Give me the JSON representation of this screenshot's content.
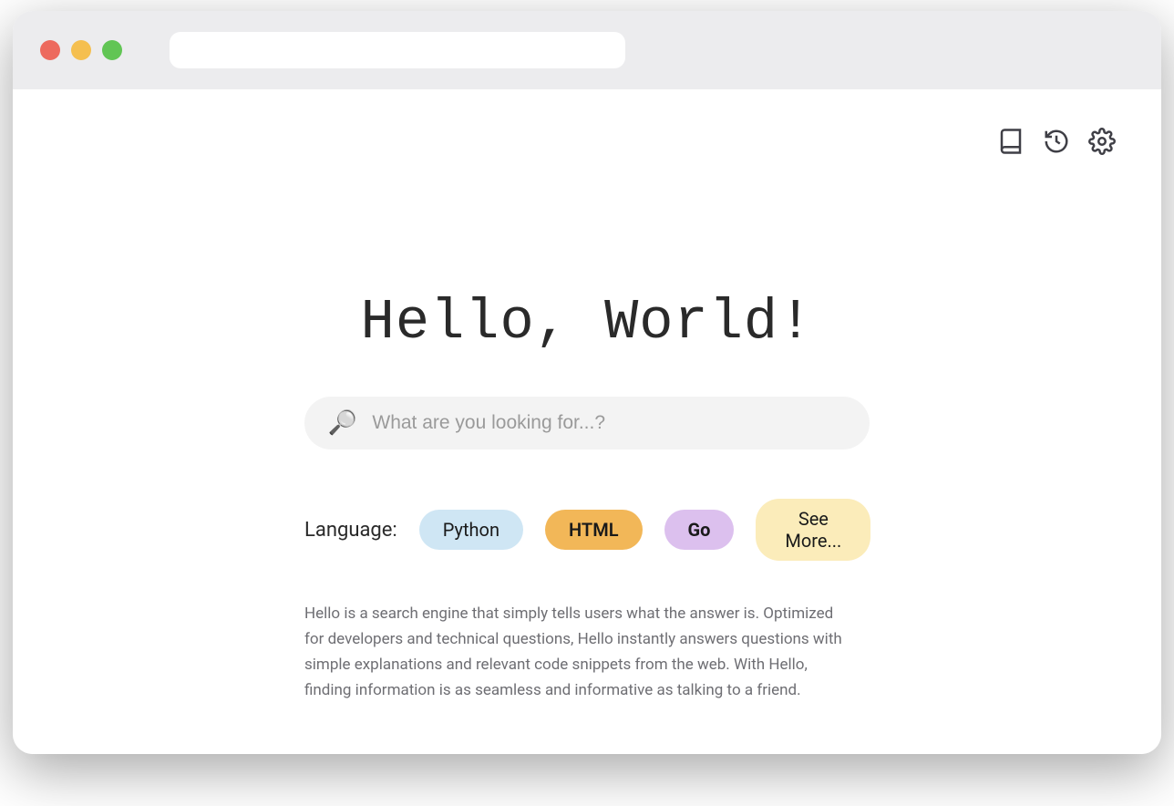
{
  "hero_title": "Hello, World!",
  "search": {
    "placeholder": "What are you looking for...?"
  },
  "language": {
    "label": "Language:",
    "pills": {
      "python": "Python",
      "html": "HTML",
      "go": "Go",
      "more": "See More..."
    }
  },
  "description": "Hello is a search engine that simply tells users what the answer is. Optimized for developers and technical questions, Hello instantly answers questions with simple explanations and relevant code snippets from the web. With Hello, finding information is as seamless and informative as talking to a friend.",
  "toolbar_icons": {
    "book": "book-icon",
    "history": "history-icon",
    "settings": "settings-icon"
  }
}
